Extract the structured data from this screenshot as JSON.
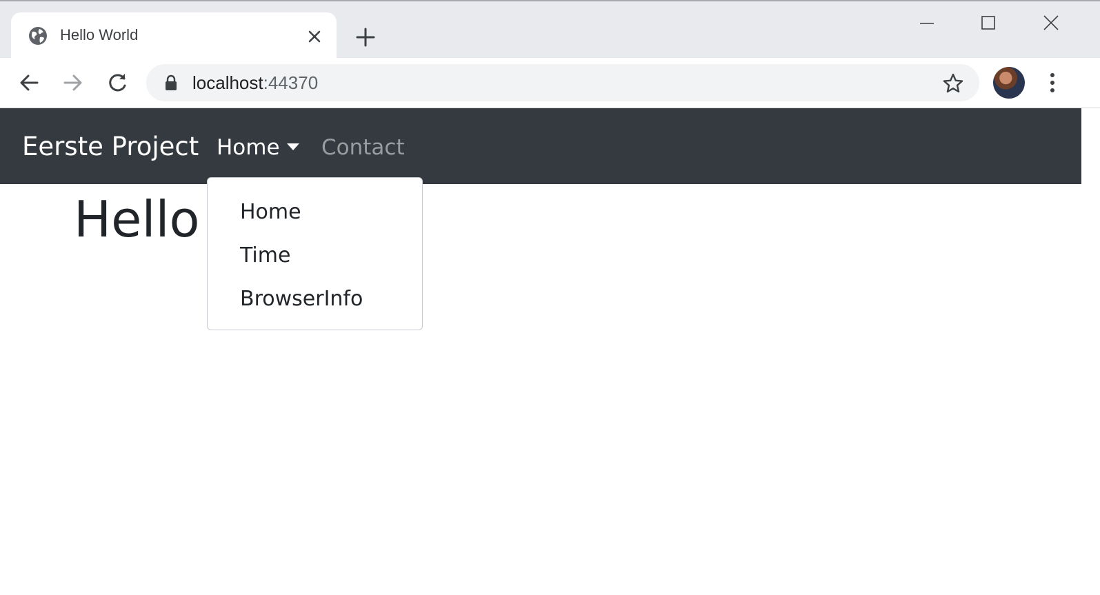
{
  "browser": {
    "tab": {
      "title": "Hello World",
      "icon": "globe-icon"
    },
    "address_bar": {
      "host": "localhost",
      "port": ":44370"
    },
    "icons": {
      "back": "back-arrow-icon",
      "forward": "forward-arrow-icon",
      "reload": "reload-icon",
      "lock": "lock-icon",
      "bookmark": "star-icon",
      "menu": "kebab-menu-icon"
    }
  },
  "navbar": {
    "brand": "Eerste Project",
    "items": [
      {
        "label": "Home",
        "active": true,
        "has_dropdown": true
      },
      {
        "label": "Contact",
        "active": false
      }
    ],
    "dropdown": {
      "open": true,
      "items": [
        "Home",
        "Time",
        "BrowserInfo"
      ]
    }
  },
  "main": {
    "heading": "Hello"
  },
  "colors": {
    "navbar_bg": "#343a40",
    "navbar_text": "#ffffff",
    "navbar_muted": "#9a9da0",
    "tabstrip_bg": "#e8eaed",
    "omnibox_bg": "#f1f3f4"
  }
}
